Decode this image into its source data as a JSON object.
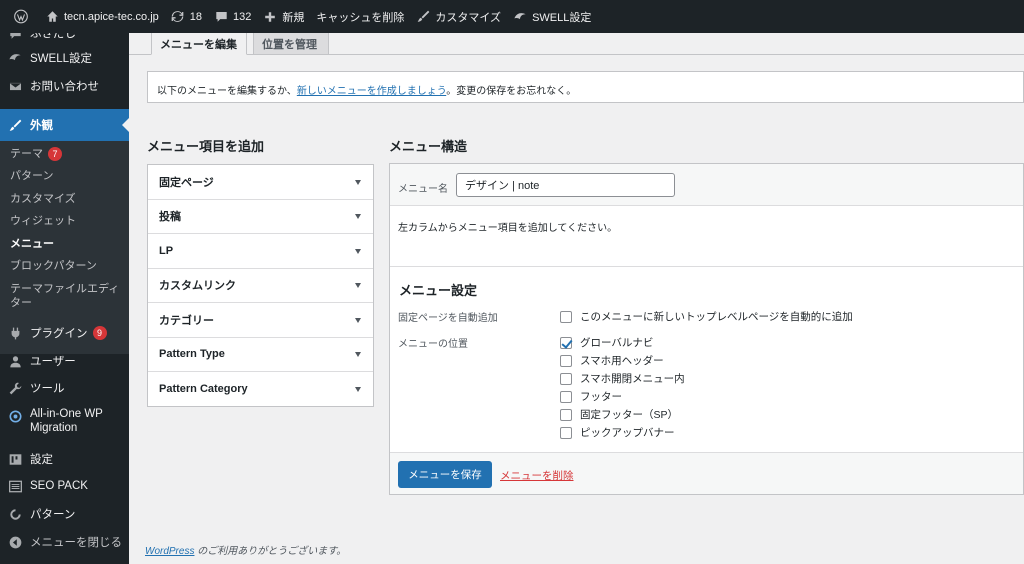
{
  "admin_bar": {
    "site_name": "tecn.apice-tec.co.jp",
    "updates_count": "18",
    "comments_count": "132",
    "new_label": "新規",
    "clear_cache_label": "キャッシュを削除",
    "customize_label": "カスタマイズ",
    "swell_label": "SWELL設定"
  },
  "sidebar": {
    "items": [
      {
        "label": "ふきだし",
        "icon": "speech-bubble-icon"
      },
      {
        "label": "SWELL設定",
        "icon": "swell-icon"
      },
      {
        "label": "お問い合わせ",
        "icon": "mail-icon"
      },
      {
        "label": "外観",
        "icon": "brush-icon",
        "active": true
      },
      {
        "label": "プラグイン",
        "icon": "plugin-icon",
        "badge": "9"
      },
      {
        "label": "ユーザー",
        "icon": "user-icon"
      },
      {
        "label": "ツール",
        "icon": "wrench-icon"
      },
      {
        "label": "All-in-One WP",
        "label2": "Migration",
        "icon": "migration-icon"
      },
      {
        "label": "設定",
        "icon": "settings-icon"
      },
      {
        "label": "SEO PACK",
        "icon": "list-icon"
      },
      {
        "label": "パターン",
        "icon": "pattern-icon"
      },
      {
        "label": "メニューを閉じる",
        "icon": "collapse-icon"
      }
    ],
    "submenu": [
      {
        "label": "テーマ",
        "badge": "7"
      },
      {
        "label": "パターン"
      },
      {
        "label": "カスタマイズ"
      },
      {
        "label": "ウィジェット"
      },
      {
        "label": "メニュー",
        "current": true
      },
      {
        "label": "ブロックパターン"
      },
      {
        "label": "テーマファイルエディ",
        "label2": "ター"
      }
    ]
  },
  "tabs": [
    {
      "label": "メニューを編集",
      "active": true
    },
    {
      "label": "位置を管理",
      "active": false
    }
  ],
  "notice": {
    "text_before": "以下のメニューを編集するか、",
    "link": "新しいメニューを作成しましょう",
    "text_after": "。変更の保存をお忘れなく。"
  },
  "add_items": {
    "title": "メニュー項目を追加",
    "sections": [
      "固定ページ",
      "投稿",
      "LP",
      "カスタムリンク",
      "カテゴリー",
      "Pattern Type",
      "Pattern Category"
    ]
  },
  "structure": {
    "title": "メニュー構造",
    "menu_name_label": "メニュー名",
    "menu_name_value": "デザイン | note",
    "instruction": "左カラムからメニュー項目を追加してください。"
  },
  "settings": {
    "title": "メニュー設定",
    "auto_add_label": "固定ページを自動追加",
    "auto_add_option": "このメニューに新しいトップレベルページを自動的に追加",
    "locations_label": "メニューの位置",
    "locations": [
      {
        "label": "グローバルナビ",
        "checked": true
      },
      {
        "label": "スマホ用ヘッダー",
        "checked": false
      },
      {
        "label": "スマホ開閉メニュー内",
        "checked": false
      },
      {
        "label": "フッター",
        "checked": false
      },
      {
        "label": "固定フッター（SP）",
        "checked": false
      },
      {
        "label": "ピックアップバナー",
        "checked": false
      }
    ]
  },
  "actions": {
    "save_label": "メニューを保存",
    "delete_label": "メニューを削除"
  },
  "footer": {
    "link": "WordPress",
    "text": " のご利用ありがとうございます。"
  },
  "colors": {
    "admin_dark": "#1d2327",
    "submenu_bg": "#2c3338",
    "accent": "#2271b1",
    "badge": "#d63638",
    "content_bg": "#f0f0f1"
  }
}
